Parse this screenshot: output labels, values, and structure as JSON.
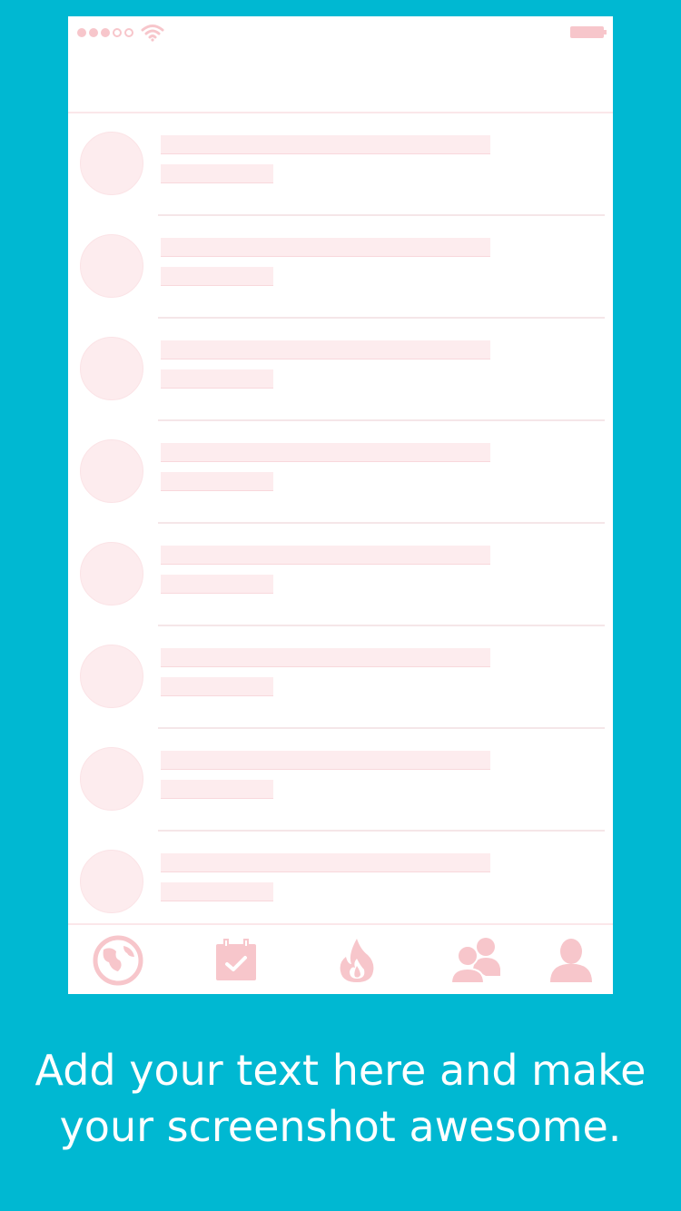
{
  "status_bar": {
    "signal_icon": "signal-dots-icon",
    "wifi_icon": "wifi-icon",
    "battery_icon": "battery-icon"
  },
  "list": {
    "rows": 8
  },
  "tab_bar": {
    "tabs": [
      {
        "icon": "globe-icon"
      },
      {
        "icon": "calendar-check-icon"
      },
      {
        "icon": "fire-icon"
      },
      {
        "icon": "group-icon"
      },
      {
        "icon": "user-icon"
      }
    ]
  },
  "caption": {
    "line1": "Add your text here and make",
    "line2": "your screenshot awesome."
  },
  "colors": {
    "background": "#00b8d2",
    "placeholder": "#fdecee",
    "accent": "#f7c6cb"
  }
}
